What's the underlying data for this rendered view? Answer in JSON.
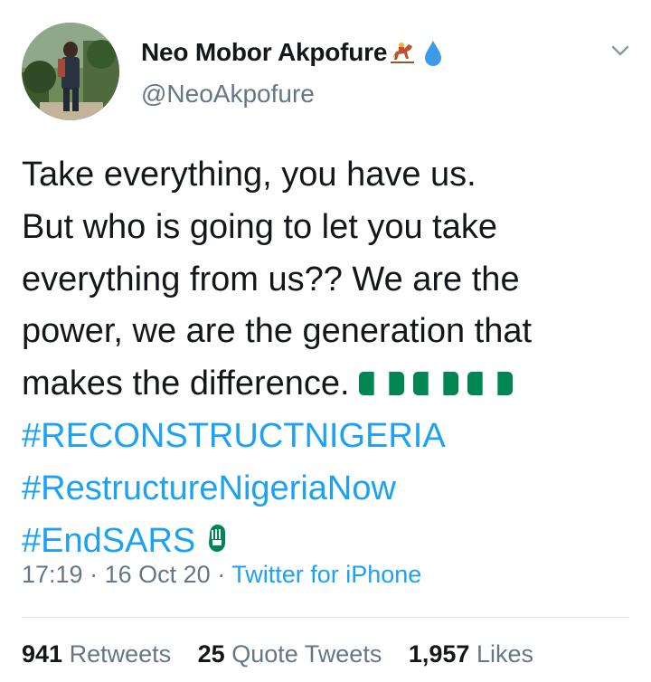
{
  "author": {
    "display_name": "Neo Mobor Akpofure",
    "handle": "@NeoAkpofure",
    "name_emojis": [
      "horse-racing-icon",
      "droplet-icon"
    ]
  },
  "tweet": {
    "lines": [
      "Take everything, you have us.",
      "But who is going to let you take",
      "everything from us?? We are the",
      "power, we are the generation that",
      "makes the difference."
    ],
    "hashtags": [
      "#RECONSTRUCTNIGERIA",
      "#RestructureNigeriaNow",
      "#EndSARS"
    ],
    "emojis": [
      "nigeria-flag-icon",
      "nigeria-flag-icon",
      "nigeria-flag-icon",
      "raised-fist-icon"
    ]
  },
  "meta": {
    "time": "17:19",
    "date": "16 Oct 20",
    "separator": "·",
    "source": "Twitter for iPhone"
  },
  "stats": {
    "retweets_count": "941",
    "retweets_label": "Retweets",
    "quotes_count": "25",
    "quotes_label": "Quote Tweets",
    "likes_count": "1,957",
    "likes_label": "Likes"
  },
  "colors": {
    "link": "#1da1f2",
    "secondary": "#657786",
    "text": "#14171a",
    "flag_green": "#008751",
    "divider": "#e1e8ed"
  }
}
